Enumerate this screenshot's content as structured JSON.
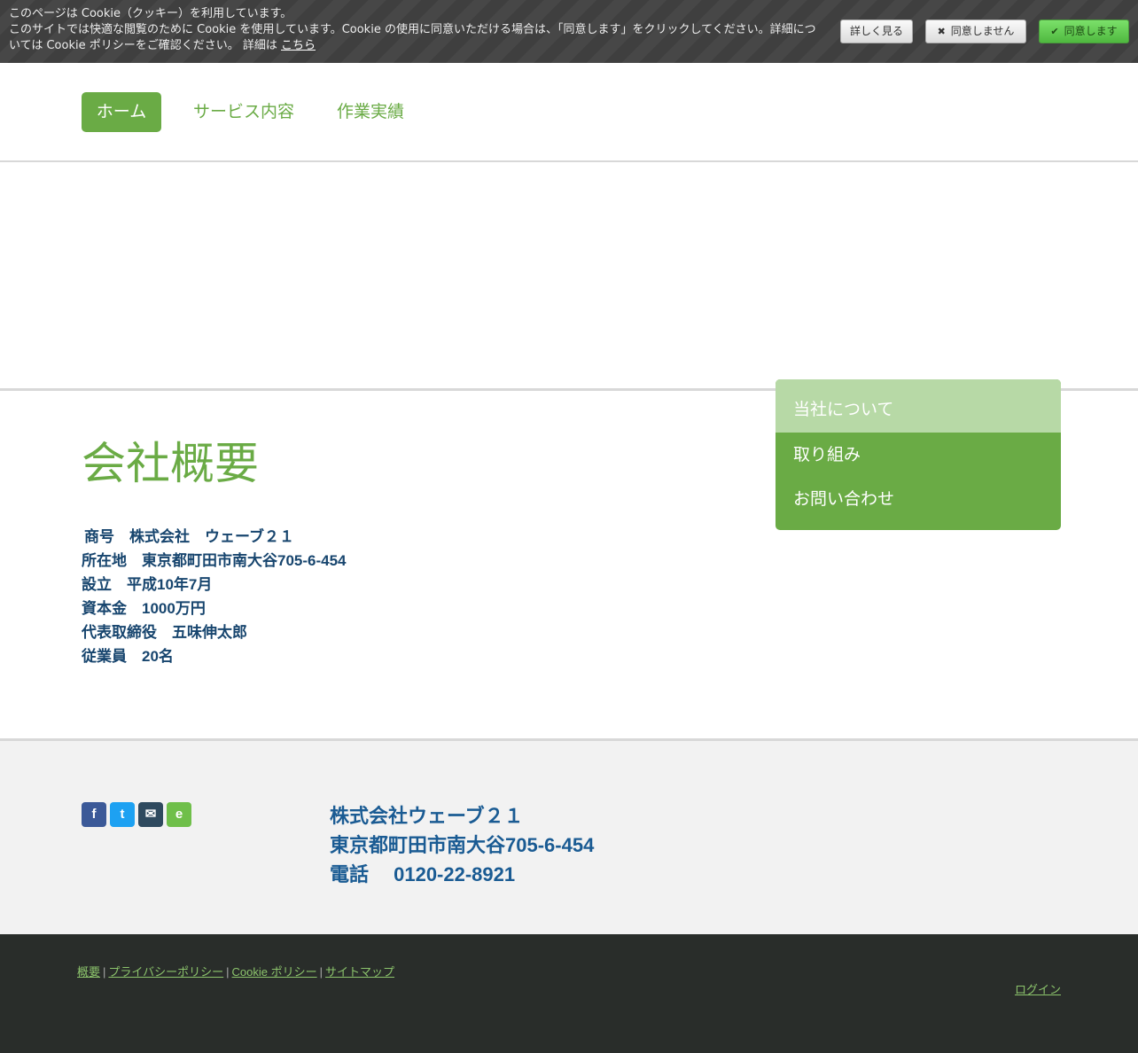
{
  "cookie": {
    "line1": "このページは Cookie（クッキー）を利用しています。",
    "line2": "このサイトでは快適な閲覧のために Cookie を使用しています。Cookie の使用に同意いただける場合は、「同意します」をクリックしてください。詳細については Cookie ポリシーをご確認ください。 詳細は",
    "link": "こちら",
    "details_label": "詳しく見る",
    "decline_label": "同意しません",
    "accept_label": "同意します"
  },
  "nav": {
    "items": [
      {
        "label": "ホーム"
      },
      {
        "label": "サービス内容"
      },
      {
        "label": "作業実績"
      }
    ]
  },
  "subnav": {
    "items": [
      {
        "label": "当社について"
      },
      {
        "label": "取り組み"
      },
      {
        "label": "お問い合わせ"
      }
    ]
  },
  "main": {
    "title": "会社概要",
    "lines": [
      "商号　株式会社　ウェーブ２１",
      "所在地　東京都町田市南大谷705-6-454",
      "設立　平成10年7月",
      "資本金　1000万円",
      "代表取締役　五味伸太郎",
      "従業員　20名"
    ]
  },
  "footer": {
    "social": {
      "facebook": "f",
      "twitter": "t",
      "mail": "✉",
      "evernote": "e"
    },
    "company_lines": [
      "株式会社ウェーブ２１",
      "東京都町田市南大谷705-6-454",
      "電話　 0120-22-8921"
    ],
    "links": [
      "概要",
      "プライバシーポリシー",
      "Cookie ポリシー",
      "サイトマップ"
    ],
    "separator": "|",
    "login": "ログイン"
  },
  "colors": {
    "accent": "#6aab45",
    "info_text": "#17456e",
    "company_text": "#1a5b93"
  }
}
